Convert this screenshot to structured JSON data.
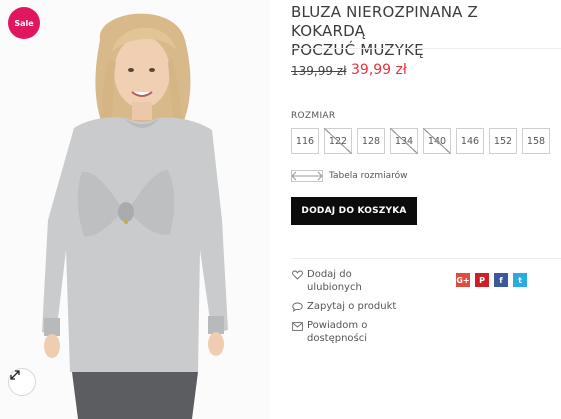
{
  "product": {
    "badge": "Sale",
    "title_line1": "BLUZA NIEROZPINANA Z KOKARDĄ",
    "title_line2": "POCZUĆ MUZYKĘ",
    "price_old": "139,99 zł",
    "price_new": "39,99 zł",
    "size_label": "ROZMIAR",
    "sizes": [
      {
        "label": "116",
        "available": true
      },
      {
        "label": "122",
        "available": false
      },
      {
        "label": "128",
        "available": true
      },
      {
        "label": "134",
        "available": false
      },
      {
        "label": "140",
        "available": false
      },
      {
        "label": "146",
        "available": true
      },
      {
        "label": "152",
        "available": true
      },
      {
        "label": "158",
        "available": true
      }
    ],
    "size_chart_label": "Tabela rozmiarów",
    "add_to_cart_label": "DODAJ DO KOSZYKA"
  },
  "actions": {
    "wishlist": "Dodaj do ulubionych",
    "ask": "Zapytaj o produkt",
    "notify": "Powiadom o dostępności"
  },
  "social": [
    {
      "name": "google-plus",
      "glyph": "G+",
      "color": "#dc4e41"
    },
    {
      "name": "pinterest",
      "glyph": "P",
      "color": "#cb2027"
    },
    {
      "name": "facebook",
      "glyph": "f",
      "color": "#3b5998"
    },
    {
      "name": "twitter",
      "glyph": "t",
      "color": "#2ba9e1"
    }
  ],
  "colors": {
    "sale": "#e0175f",
    "price_new": "#e3333c",
    "button": "#0c0c0c"
  }
}
